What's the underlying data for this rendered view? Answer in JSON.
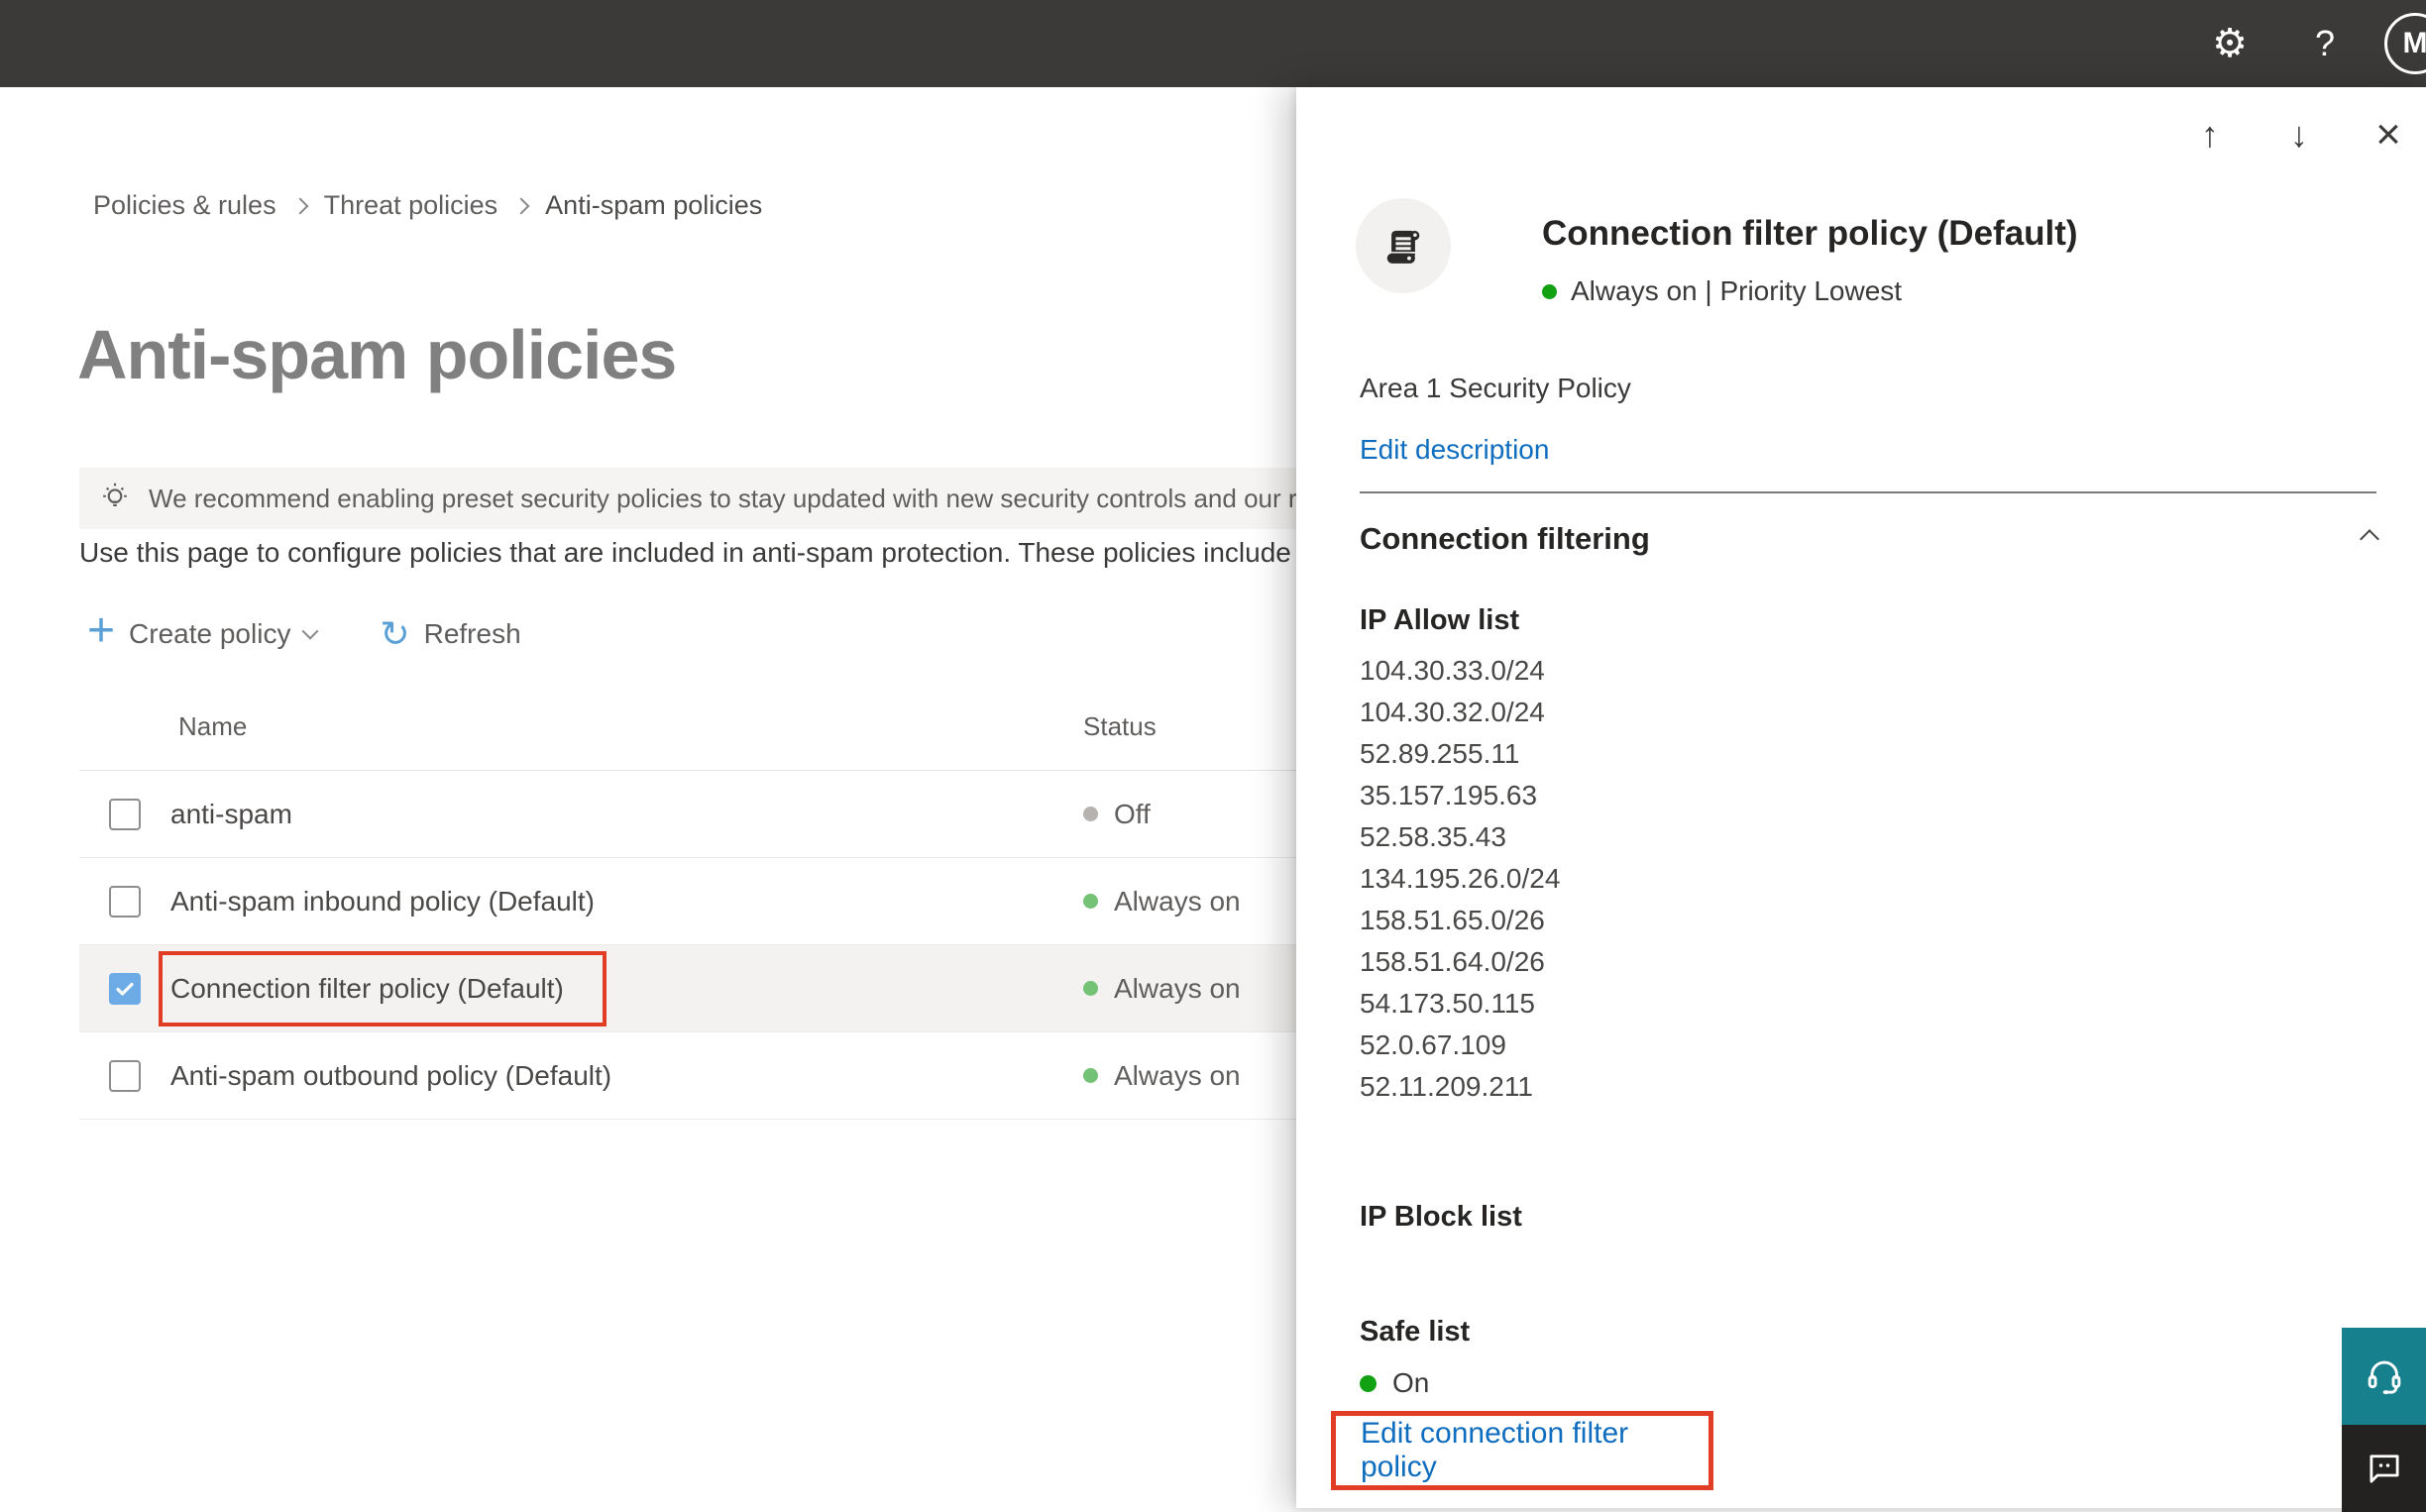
{
  "icons": {
    "gear": "⚙",
    "help": "?",
    "up": "↑",
    "down": "↓",
    "close": "×",
    "plus": "+",
    "refresh": "↻"
  },
  "topbar": {
    "avatar_initial": "M"
  },
  "breadcrumb": {
    "items": [
      "Policies & rules",
      "Threat policies",
      "Anti-spam policies"
    ]
  },
  "page": {
    "title": "Anti-spam policies",
    "banner": "We recommend enabling preset security policies to stay updated with new security controls and our recomme",
    "intro": "Use this page to configure policies that are included in anti-spam protection. These policies include"
  },
  "toolbar": {
    "create_label": "Create policy",
    "refresh_label": "Refresh"
  },
  "table": {
    "columns": {
      "name": "Name",
      "status": "Status"
    },
    "rows": [
      {
        "name": "anti-spam",
        "status": "Off",
        "status_class": "dot-off",
        "row_class": "",
        "cb_class": ""
      },
      {
        "name": "Anti-spam inbound policy (Default)",
        "status": "Always on",
        "status_class": "dot-on",
        "row_class": "",
        "cb_class": ""
      },
      {
        "name": "Connection filter policy (Default)",
        "status": "Always on",
        "status_class": "dot-on",
        "row_class": "selected",
        "cb_class": "checked"
      },
      {
        "name": "Anti-spam outbound policy (Default)",
        "status": "Always on",
        "status_class": "dot-on",
        "row_class": "",
        "cb_class": ""
      }
    ]
  },
  "flyout": {
    "title": "Connection filter policy (Default)",
    "status_line": "Always on | Priority Lowest",
    "description": "Area 1 Security Policy",
    "edit_description_label": "Edit description",
    "section_title": "Connection filtering",
    "ip_allow_label": "IP Allow list",
    "ip_allow": [
      "104.30.33.0/24",
      "104.30.32.0/24",
      "52.89.255.11",
      "35.157.195.63",
      "52.58.35.43",
      "134.195.26.0/24",
      "158.51.65.0/26",
      "158.51.64.0/26",
      "54.173.50.115",
      "52.0.67.109",
      "52.11.209.211"
    ],
    "ip_block_label": "IP Block list",
    "safe_list_label": "Safe list",
    "safe_list_status": "On",
    "edit_link_label": "Edit connection filter policy"
  },
  "colors": {
    "topbar_bg": "#3b3a38",
    "accent_blue": "#0e6dbe",
    "green_vivid": "#12a112",
    "green_soft": "#74c276",
    "gray_off": "#b5b2b0",
    "annotation_red": "#e13c25",
    "checkbox_blue": "#6cabe5",
    "teal": "#16808d",
    "feedback_dark": "#232221"
  }
}
